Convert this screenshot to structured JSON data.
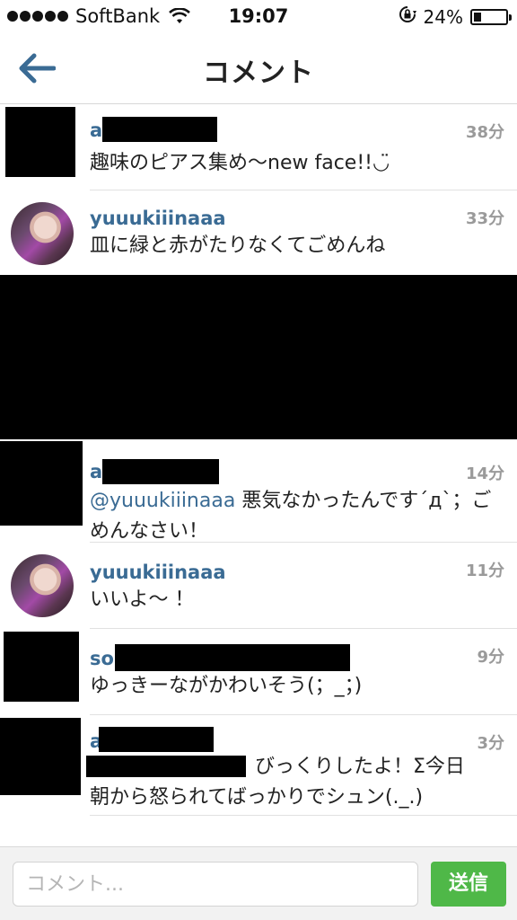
{
  "status_bar": {
    "carrier": "SoftBank",
    "time": "19:07",
    "battery_percent_label": "24%",
    "battery_level": 0.24,
    "icons": [
      "signal-dots-icon",
      "wifi-icon",
      "rotation-lock-icon",
      "battery-icon"
    ]
  },
  "nav": {
    "title": "コメント",
    "back_icon": "back-arrow-icon"
  },
  "comments": [
    {
      "username": "a",
      "text": "趣味のピアス集め〜new face!!◡̈",
      "time": "38分",
      "avatar": "redacted"
    },
    {
      "username": "yuuukiiinaaa",
      "text": "皿に緑と赤がたりなくてごめんね",
      "time": "33分",
      "avatar": "photo"
    },
    {
      "username": "a",
      "mention": "@yuuukiiinaaa",
      "text": " 悪気なかったんです´д`；ごめんなさい！",
      "time": "14分",
      "avatar": "redacted"
    },
    {
      "username": "yuuukiiinaaa",
      "text": "いいよ〜 ！",
      "time": "11分",
      "avatar": "photo"
    },
    {
      "username": "so",
      "text": "ゆっきーながかわいそう(；_；)",
      "time": "9分",
      "avatar": "redacted"
    },
    {
      "username": "a",
      "text_line1": "びっくりしたよ！Σ今日",
      "text_line2": "朝から怒られてばっかりでシュン(._.)",
      "time": "3分",
      "avatar": "redacted"
    }
  ],
  "input": {
    "placeholder": "コメント...",
    "send_label": "送信"
  },
  "colors": {
    "username": "#3a6b94",
    "send_button": "#4fb848",
    "timestamp": "#9a9a9a"
  }
}
